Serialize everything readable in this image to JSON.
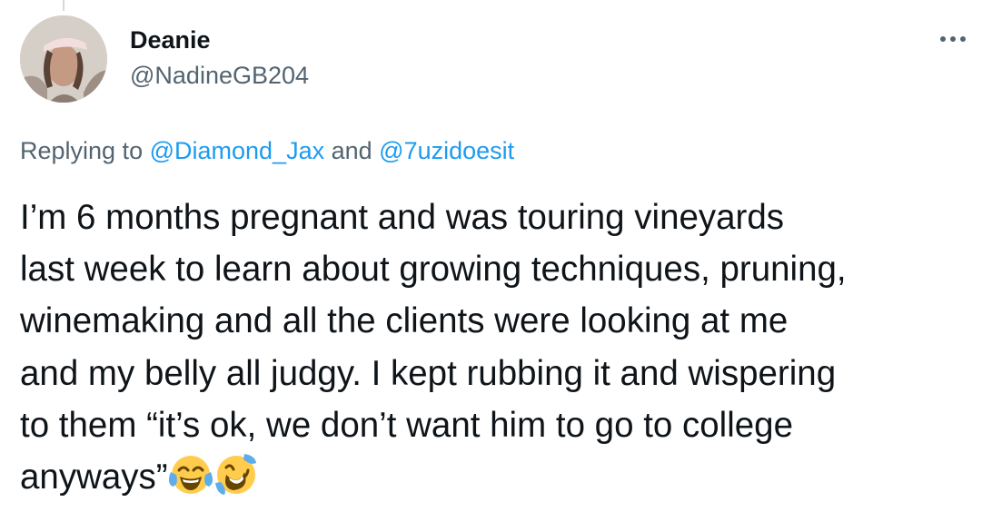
{
  "author": {
    "display_name": "Deanie",
    "handle": "@NadineGB204",
    "avatar_icon": "profile-photo-avatar"
  },
  "more_icon": "more-horizontal-icon",
  "reply_context": {
    "prefix": "Replying to ",
    "mention_1": "@Diamond_Jax",
    "conjunction": " and ",
    "mention_2": "@7uzidoesit"
  },
  "tweet": {
    "lines": [
      "I’m 6 months pregnant and was touring vineyards",
      "last week to learn about growing techniques, pruning,",
      "winemaking and all the clients were looking at me",
      "and my belly all judgy.  I kept rubbing it and wispering",
      "to them “it’s ok, we don’t want him to go to college",
      "anyways”"
    ],
    "emojis": [
      "face-with-tears-of-joy-emoji",
      "rolling-on-floor-laughing-emoji"
    ]
  },
  "colors": {
    "text_primary": "#0f1419",
    "text_secondary": "#536471",
    "link": "#1d9bf0",
    "thread_line": "#cfd9de"
  }
}
